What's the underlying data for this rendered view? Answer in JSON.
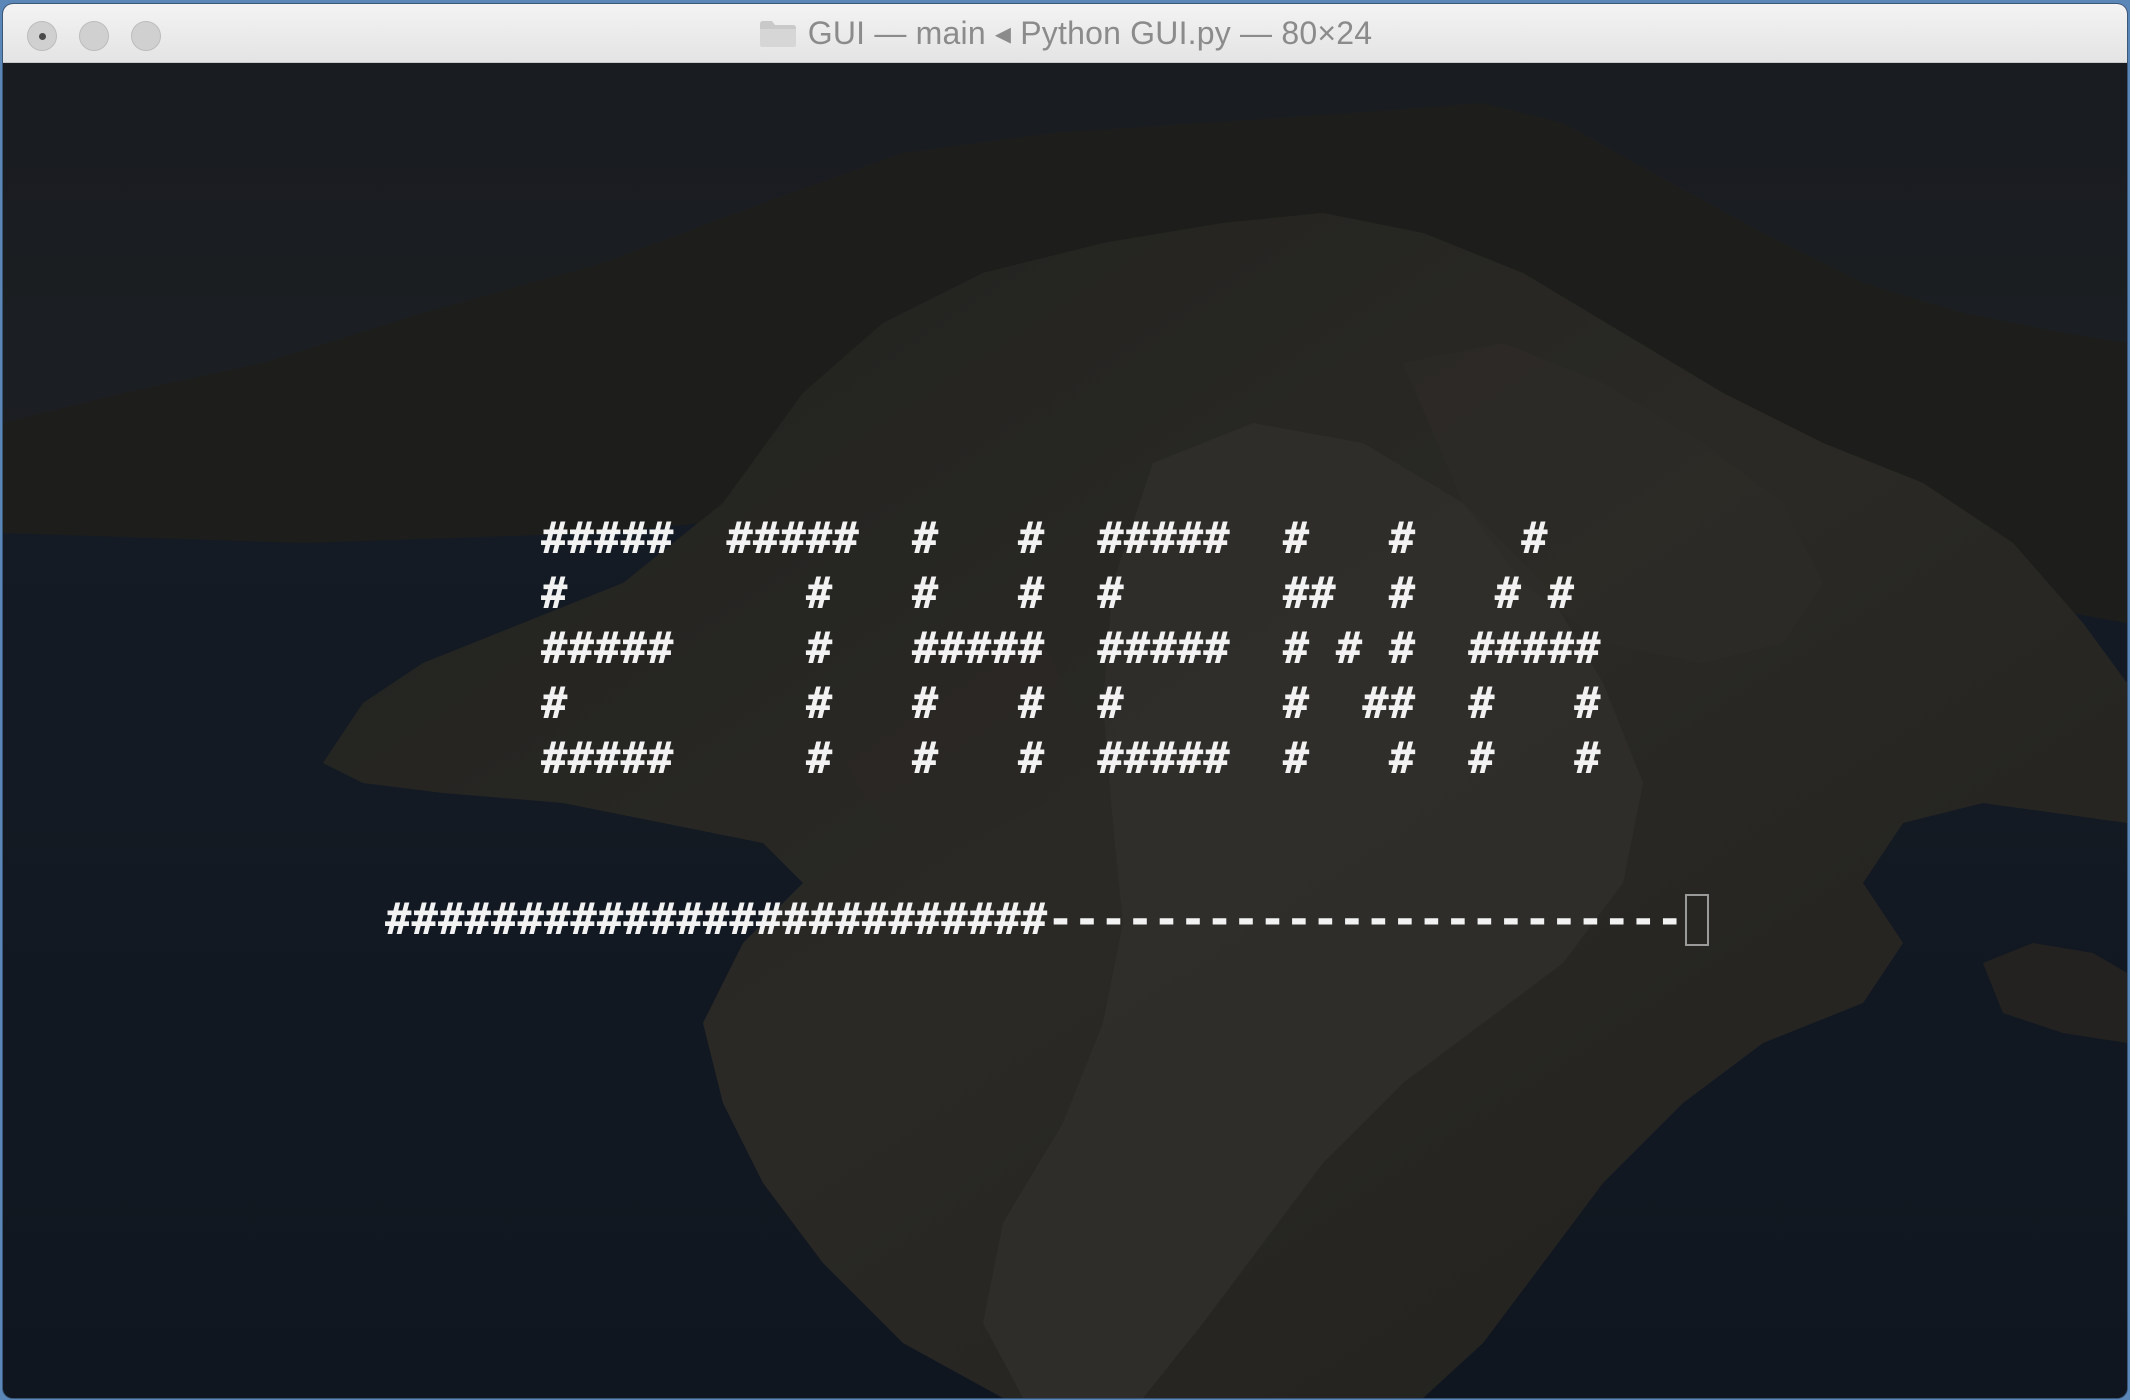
{
  "window": {
    "title": "GUI — main ◂ Python GUI.py — 80×24"
  },
  "terminal": {
    "ascii_banner": [
      "#####  #####  #   #  #####  #   #    #",
      "#         #   #   #  #      ##  #   # #",
      "#####     #   #####  #####  # # #  #####",
      "#         #   #   #  #      #  ##  #   #",
      "#####     #   #   #  #####  #   #  #   #"
    ],
    "progress_bar": {
      "filled": "#########################",
      "empty": "------------------------",
      "progress_fraction": 0.51
    },
    "cursor": "block-cursor"
  },
  "colors": {
    "text": "#f2f2f2",
    "titlebar": "#e8e8e8",
    "title_text": "#8b8b8b"
  }
}
